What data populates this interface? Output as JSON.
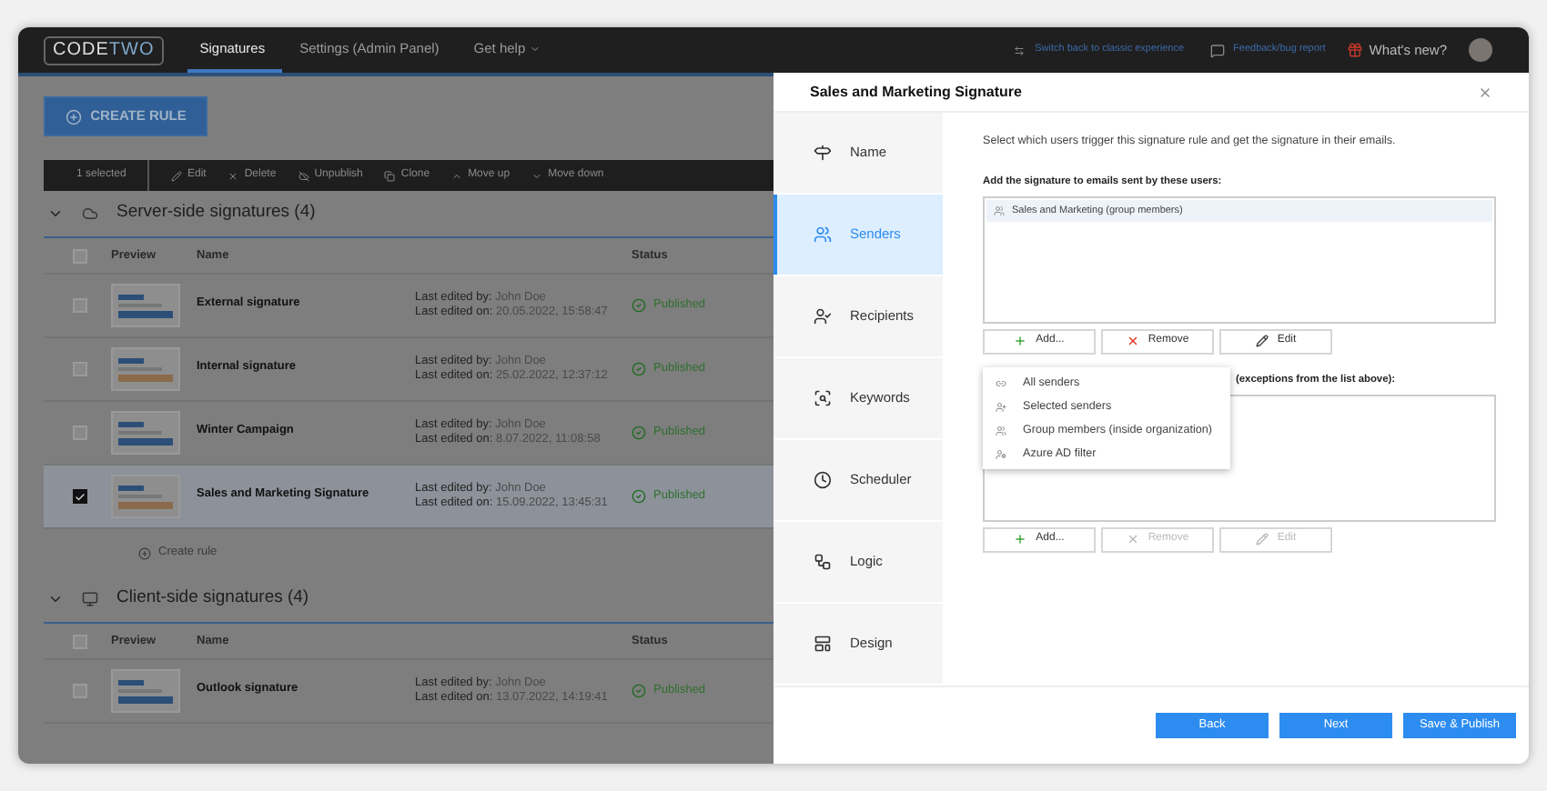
{
  "topbar": {
    "logo": [
      "CODE",
      "TWO"
    ],
    "tabs": [
      {
        "label": "Signatures",
        "selected": true,
        "dropdown": false
      },
      {
        "label": "Settings (Admin Panel)",
        "selected": false,
        "dropdown": false
      },
      {
        "label": "Get help",
        "selected": false,
        "dropdown": true
      }
    ],
    "links": [
      "Switch back to classic experience",
      "Feedback/bug report"
    ],
    "whats_new": "What's new?"
  },
  "create_button": "CREATE RULE",
  "toolbar": {
    "selection": "1 selected",
    "actions": [
      "Edit",
      "Delete",
      "Unpublish",
      "Clone",
      "Move up",
      "Move down"
    ]
  },
  "sections": [
    {
      "kind": "server",
      "title": "Server-side signatures (4)",
      "columns": [
        "Preview",
        "Name",
        "Status"
      ],
      "header_checked": false,
      "rows": [
        {
          "name": "External signature",
          "edited_by_label": "Last edited by:",
          "edited_by": "John Doe",
          "edited_on_label": "Last edited on:",
          "edited_on": "20.05.2022, 15:58:47",
          "status": "Published",
          "checked": false
        },
        {
          "name": "Internal signature",
          "edited_by_label": "Last edited by:",
          "edited_by": "John Doe",
          "edited_on_label": "Last edited on:",
          "edited_on": "25.02.2022, 12:37:12",
          "status": "Published",
          "checked": false
        },
        {
          "name": "Winter Campaign",
          "edited_by_label": "Last edited by:",
          "edited_by": "John Doe",
          "edited_on_label": "Last edited on:",
          "edited_on": "8.07.2022, 11:08:58",
          "status": "Published",
          "checked": false
        },
        {
          "name": "Sales and Marketing Signature",
          "edited_by_label": "Last edited by:",
          "edited_by": "John Doe",
          "edited_on_label": "Last edited on:",
          "edited_on": "15.09.2022, 13:45:31",
          "status": "Published",
          "checked": true
        }
      ],
      "create_link": "Create rule"
    },
    {
      "kind": "client",
      "title": "Client-side signatures (4)",
      "columns": [
        "Preview",
        "Name",
        "Status"
      ],
      "header_checked": false,
      "rows": [
        {
          "name": "Outlook signature",
          "edited_by_label": "Last edited by:",
          "edited_by": "John Doe",
          "edited_on_label": "Last edited on:",
          "edited_on": "13.07.2022, 14:19:41",
          "status": "Published",
          "checked": false
        }
      ]
    }
  ],
  "dialog": {
    "title": "Sales and Marketing Signature",
    "nav": [
      {
        "kind": "name",
        "label": "Name",
        "selected": false
      },
      {
        "kind": "senders",
        "label": "Senders",
        "selected": true
      },
      {
        "kind": "recipients",
        "label": "Recipients",
        "selected": false
      },
      {
        "kind": "keywords",
        "label": "Keywords",
        "selected": false
      },
      {
        "kind": "scheduler",
        "label": "Scheduler",
        "selected": false
      },
      {
        "kind": "logic",
        "label": "Logic",
        "selected": false
      },
      {
        "kind": "design",
        "label": "Design",
        "selected": false
      }
    ],
    "description": "Select which users trigger this signature rule and get the signature in their emails.",
    "include_label": "Add the signature to emails sent by these users:",
    "include_items": [
      "Sales and Marketing (group members)"
    ],
    "include_buttons": [
      {
        "kind": "add",
        "label": "Add...",
        "disabled": false
      },
      {
        "kind": "remove",
        "label": "Remove",
        "disabled": false
      },
      {
        "kind": "edit",
        "label": "Edit",
        "disabled": false
      }
    ],
    "exclude_label": "(exceptions from the list above):",
    "exclude_buttons": [
      {
        "kind": "add",
        "label": "Add...",
        "disabled": false
      },
      {
        "kind": "remove",
        "label": "Remove",
        "disabled": true
      },
      {
        "kind": "edit",
        "label": "Edit",
        "disabled": true
      }
    ],
    "add_menu": [
      {
        "kind": "all",
        "label": "All senders"
      },
      {
        "kind": "selected",
        "label": "Selected senders"
      },
      {
        "kind": "group",
        "label": "Group members (inside organization)"
      },
      {
        "kind": "azure",
        "label": "Azure AD filter"
      }
    ],
    "footer_buttons": [
      "Back",
      "Next",
      "Save & Publish"
    ]
  }
}
